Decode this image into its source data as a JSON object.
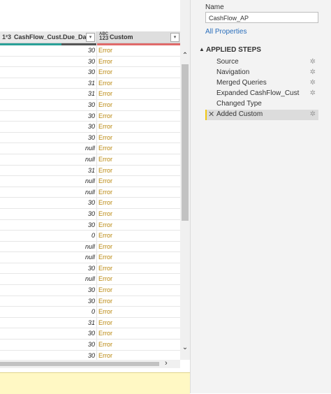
{
  "grid": {
    "col1": {
      "type_icon": "1²3",
      "header": "CashFlow_Cust.Due_Days"
    },
    "col2": {
      "type_icon_top": "ABC",
      "type_icon_bottom": "123",
      "header": "Custom"
    },
    "dropdown_glyph": "▾",
    "rows": [
      {
        "value": "30",
        "custom": "Error"
      },
      {
        "value": "30",
        "custom": "Error"
      },
      {
        "value": "30",
        "custom": "Error"
      },
      {
        "value": "31",
        "custom": "Error"
      },
      {
        "value": "31",
        "custom": "Error"
      },
      {
        "value": "30",
        "custom": "Error"
      },
      {
        "value": "30",
        "custom": "Error"
      },
      {
        "value": "30",
        "custom": "Error"
      },
      {
        "value": "30",
        "custom": "Error"
      },
      {
        "value": "null",
        "custom": "Error"
      },
      {
        "value": "null",
        "custom": "Error"
      },
      {
        "value": "31",
        "custom": "Error"
      },
      {
        "value": "null",
        "custom": "Error"
      },
      {
        "value": "null",
        "custom": "Error"
      },
      {
        "value": "30",
        "custom": "Error"
      },
      {
        "value": "30",
        "custom": "Error"
      },
      {
        "value": "30",
        "custom": "Error"
      },
      {
        "value": "0",
        "custom": "Error"
      },
      {
        "value": "null",
        "custom": "Error"
      },
      {
        "value": "null",
        "custom": "Error"
      },
      {
        "value": "30",
        "custom": "Error"
      },
      {
        "value": "null",
        "custom": "Error"
      },
      {
        "value": "30",
        "custom": "Error"
      },
      {
        "value": "30",
        "custom": "Error"
      },
      {
        "value": "0",
        "custom": "Error"
      },
      {
        "value": "31",
        "custom": "Error"
      },
      {
        "value": "30",
        "custom": "Error"
      },
      {
        "value": "30",
        "custom": "Error"
      },
      {
        "value": "30",
        "custom": "Error"
      }
    ]
  },
  "query_settings": {
    "name_label": "Name",
    "name_value": "CashFlow_AP",
    "all_properties": "All Properties",
    "applied_steps_title": "APPLIED STEPS",
    "steps": [
      {
        "label": "Source"
      },
      {
        "label": "Navigation"
      },
      {
        "label": "Merged Queries"
      },
      {
        "label": "Expanded CashFlow_Cust"
      },
      {
        "label": "Changed Type"
      },
      {
        "label": "Added Custom"
      }
    ]
  },
  "colors": {
    "error_text": "#b8860b",
    "link": "#2a6ebb",
    "quality_valid": "#2aa198",
    "quality_error": "#e06a6a",
    "selected_step_bar": "#f2c811"
  }
}
